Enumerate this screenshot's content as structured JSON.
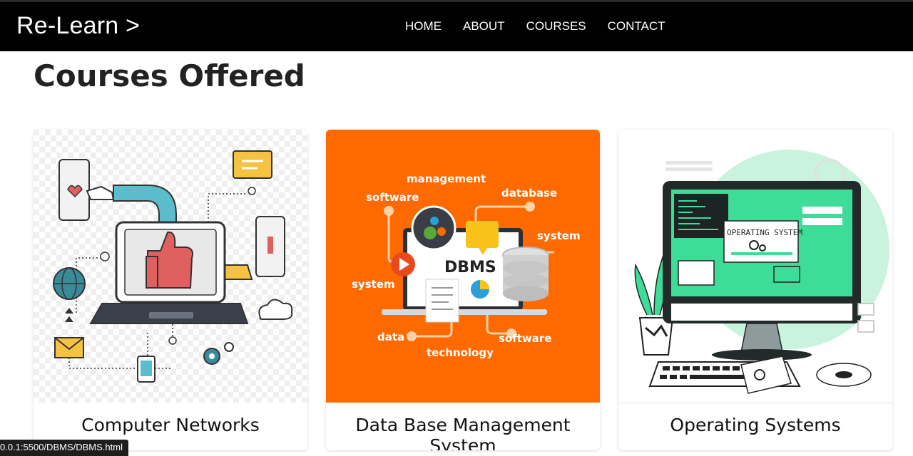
{
  "navbar": {
    "brand": "Re-Learn >",
    "links": [
      "HOME",
      "ABOUT",
      "COURSES",
      "CONTACT"
    ]
  },
  "page": {
    "title": "Courses Offered"
  },
  "cards": [
    {
      "title": "Computer Networks"
    },
    {
      "title": "Data Base Management System",
      "image_labels": {
        "center": "DBMS",
        "management": "management",
        "software_top": "software",
        "database": "database",
        "system_right": "system",
        "system_left": "system",
        "data": "data",
        "technology": "technology",
        "software_bottom": "software"
      }
    },
    {
      "title": "Operating Systems",
      "image_labels": {
        "screen": "OPERATING SYSTEM"
      }
    }
  ],
  "status_bar": {
    "url": "0.0.1:5500/DBMS/DBMS.html"
  },
  "colors": {
    "navbar": "#000000",
    "dbms_bg": "#ff6a00",
    "os_accent": "#3ddc97",
    "network_accent": "#5bbccc"
  }
}
